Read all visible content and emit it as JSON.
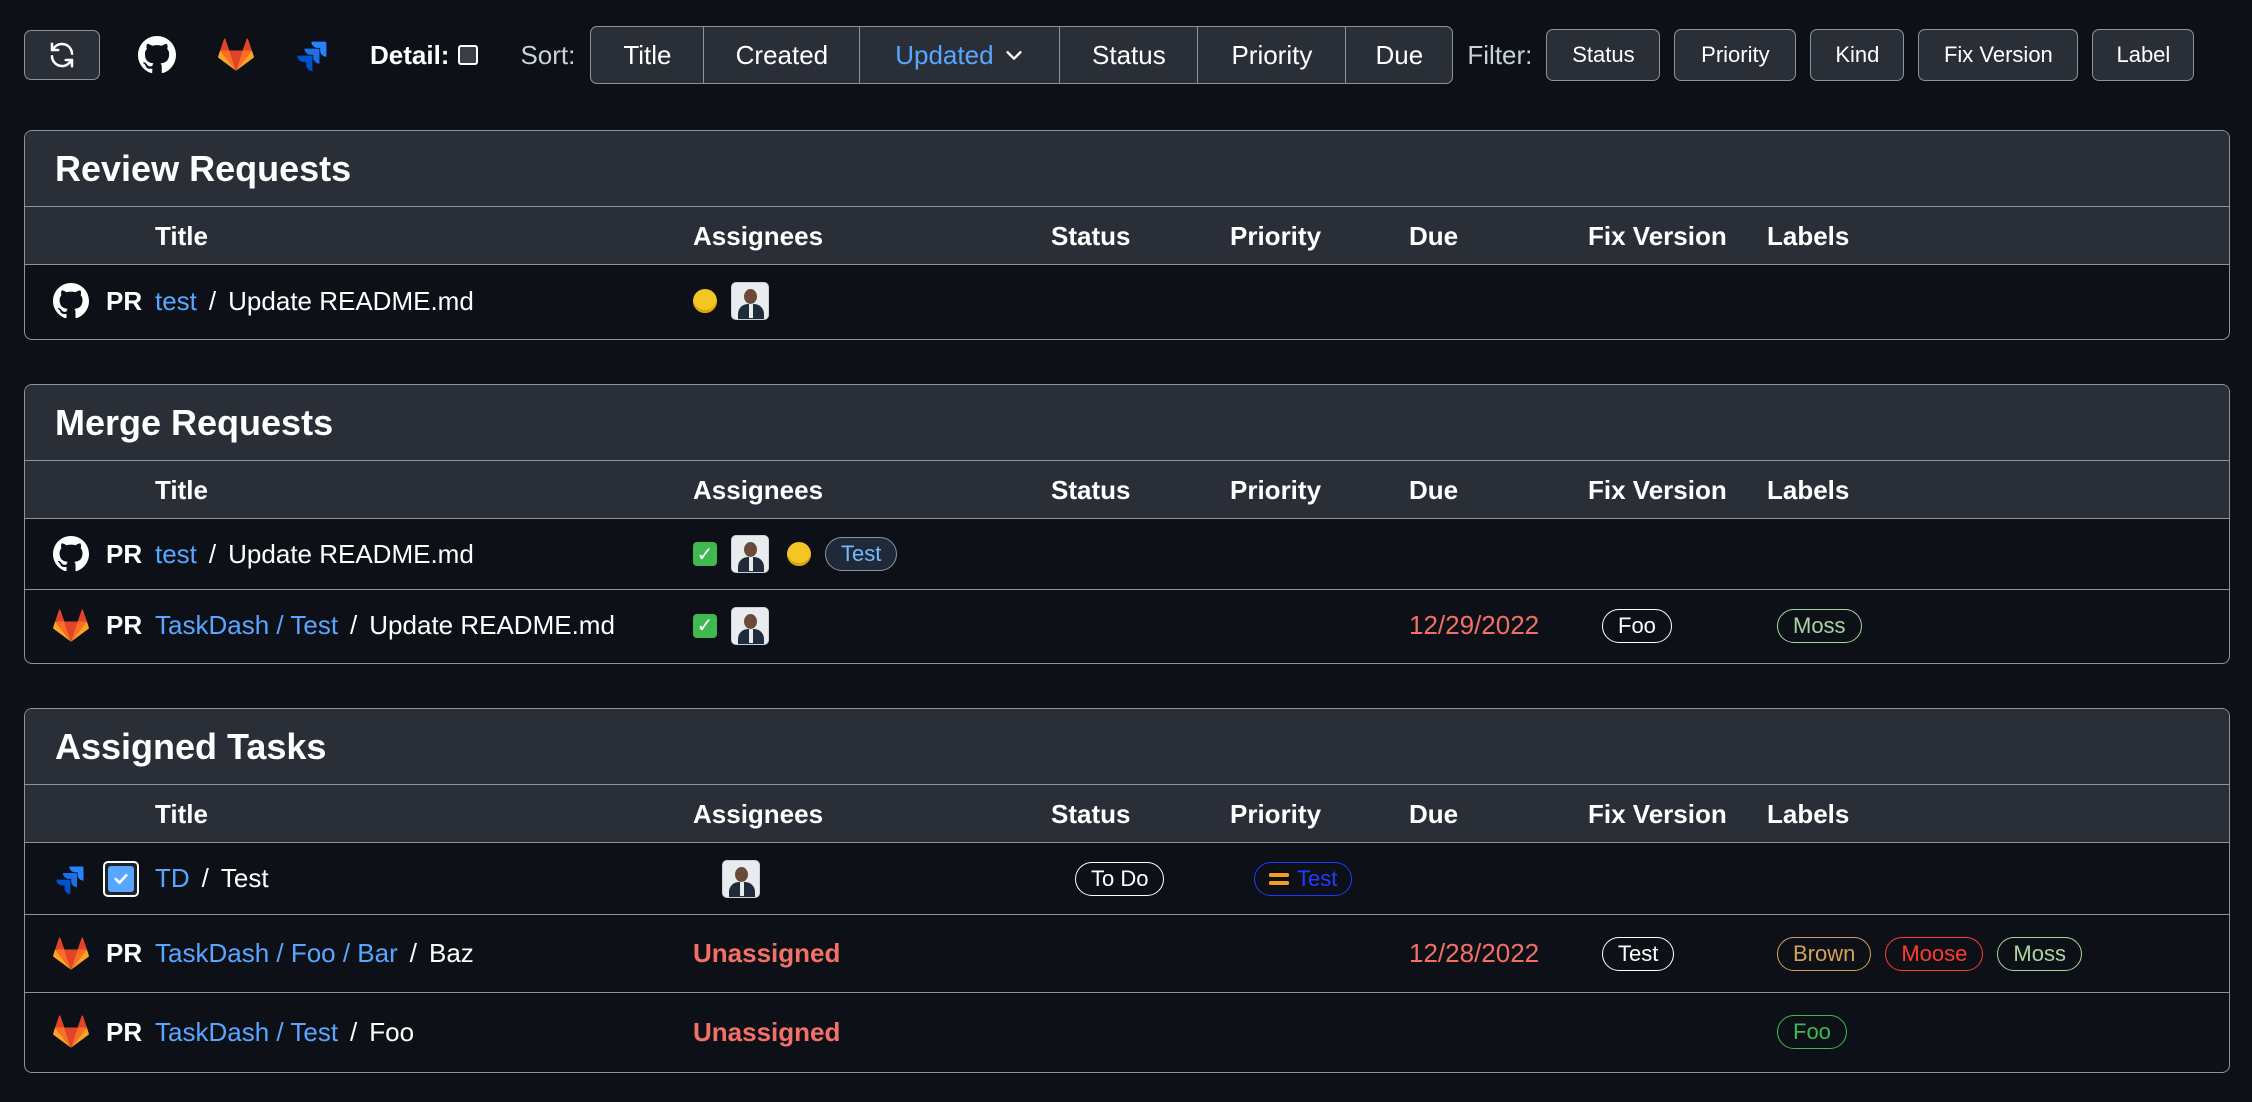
{
  "toolbar": {
    "detail_label": "Detail:",
    "sort_label": "Sort:",
    "sort_options": [
      "Title",
      "Created",
      "Updated",
      "Status",
      "Priority",
      "Due"
    ],
    "active_sort": "Updated",
    "filter_label": "Filter:",
    "filters": [
      "Status",
      "Priority",
      "Kind",
      "Fix Version",
      "Label"
    ]
  },
  "columns": {
    "title": "Title",
    "assignees": "Assignees",
    "status": "Status",
    "priority": "Priority",
    "due": "Due",
    "fix_version": "Fix Version",
    "labels": "Labels"
  },
  "sections": {
    "review": {
      "title": "Review Requests",
      "rows": [
        {
          "kind": "PR",
          "repo": "test",
          "sep": "/",
          "title": "Update README.md"
        }
      ]
    },
    "merge": {
      "title": "Merge Requests",
      "rows": [
        {
          "kind": "PR",
          "repo": "test",
          "sep": "/",
          "title": "Update README.md",
          "badge": "Test"
        },
        {
          "kind": "PR",
          "repo": "TaskDash / Test",
          "sep": "/",
          "title": "Update README.md",
          "due": "12/29/2022",
          "fix_version": "Foo",
          "labels": [
            "Moss"
          ]
        }
      ]
    },
    "tasks": {
      "title": "Assigned Tasks",
      "rows": [
        {
          "kind": "",
          "repo": "TD",
          "sep": "/",
          "title": "Test",
          "status": "To Do",
          "priority": "Test"
        },
        {
          "kind": "PR",
          "repo": "TaskDash / Foo / Bar",
          "sep": "/",
          "title": "Baz",
          "assignee": "Unassigned",
          "due": "12/28/2022",
          "fix_version": "Test",
          "labels": [
            "Brown",
            "Moose",
            "Moss"
          ]
        },
        {
          "kind": "PR",
          "repo": "TaskDash / Test",
          "sep": "/",
          "title": "Foo",
          "assignee": "Unassigned",
          "labels": [
            "Foo"
          ]
        }
      ]
    }
  },
  "colors": {
    "background": "#0d1117",
    "panel": "#2a2f37",
    "link": "#58a6ff",
    "due": "#f47067",
    "label_brown": "#d1a15b",
    "label_moose": "#ff3b30",
    "label_moss": "#a8d5a2",
    "label_foo": "#3fb950",
    "priority_border": "#1f3bff",
    "priority_icon": "#f0a020"
  }
}
